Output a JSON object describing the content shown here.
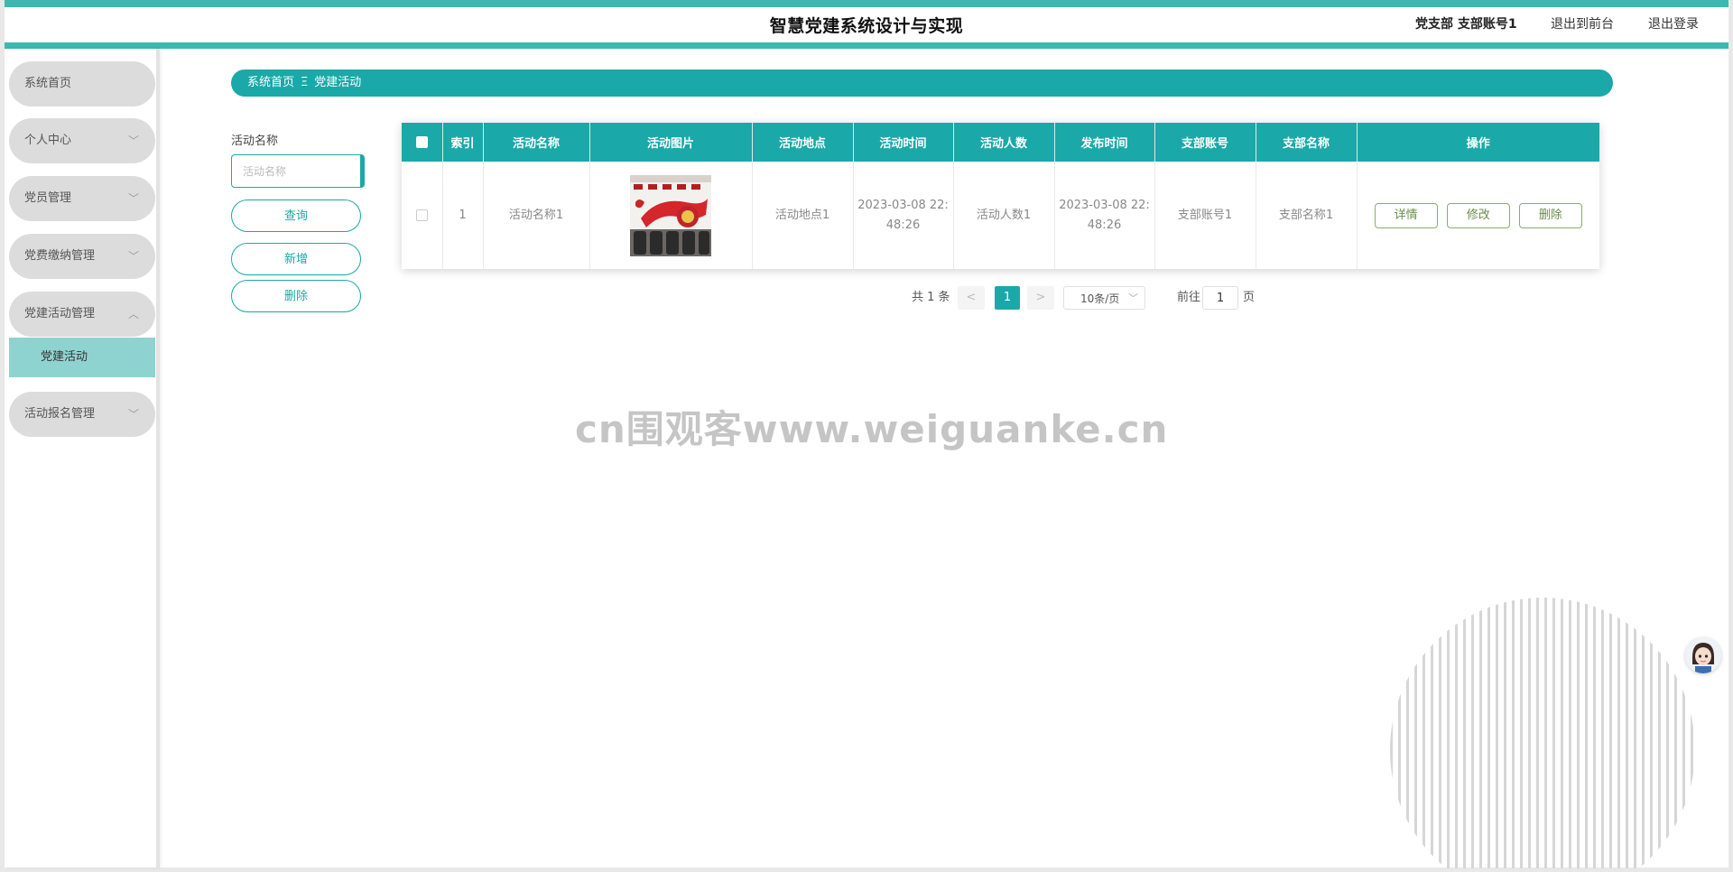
{
  "header": {
    "title": "智慧党建系统设计与实现",
    "user": "党支部 支部账号1",
    "back_to_front": "退出到前台",
    "logout": "退出登录"
  },
  "sidebar": {
    "items": [
      {
        "label": "系统首页"
      },
      {
        "label": "个人中心"
      },
      {
        "label": "党员管理"
      },
      {
        "label": "党费缴纳管理"
      },
      {
        "label": "党建活动管理"
      },
      {
        "label": "党建活动"
      },
      {
        "label": "活动报名管理"
      }
    ]
  },
  "breadcrumb": {
    "home": "系统首页",
    "separator": "Ξ",
    "current": "党建活动"
  },
  "search": {
    "label": "活动名称",
    "placeholder": "活动名称",
    "query_button": "查询",
    "add_button": "新增",
    "delete_button": "删除"
  },
  "table": {
    "headers": [
      "索引",
      "活动名称",
      "活动图片",
      "活动地点",
      "活动时间",
      "活动人数",
      "发布时间",
      "支部账号",
      "支部名称",
      "操作"
    ],
    "rows": [
      {
        "index": "1",
        "name": "活动名称1",
        "location": "活动地点1",
        "time_line1": "2023-03-08 22:",
        "time_line2": "48:26",
        "people": "活动人数1",
        "publish_line1": "2023-03-08 22:",
        "publish_line2": "48:26",
        "branch_account": "支部账号1",
        "branch_name": "支部名称1",
        "actions": [
          "详情",
          "修改",
          "删除"
        ]
      }
    ]
  },
  "pagination": {
    "total": "共 1 条",
    "prev": "<",
    "current_page": "1",
    "next": ">",
    "page_size": "10条/页",
    "goto_prefix": "前往",
    "goto_value": "1",
    "goto_suffix": "页"
  },
  "watermark": "cn围观客www.weiguanke.cn",
  "colors": {
    "accent": "#1ba8a8",
    "frame": "#3db8b1",
    "submenu_active": "#8fd3d1",
    "menu_bg": "#dcdcdc",
    "action_border": "#8cab6f"
  }
}
